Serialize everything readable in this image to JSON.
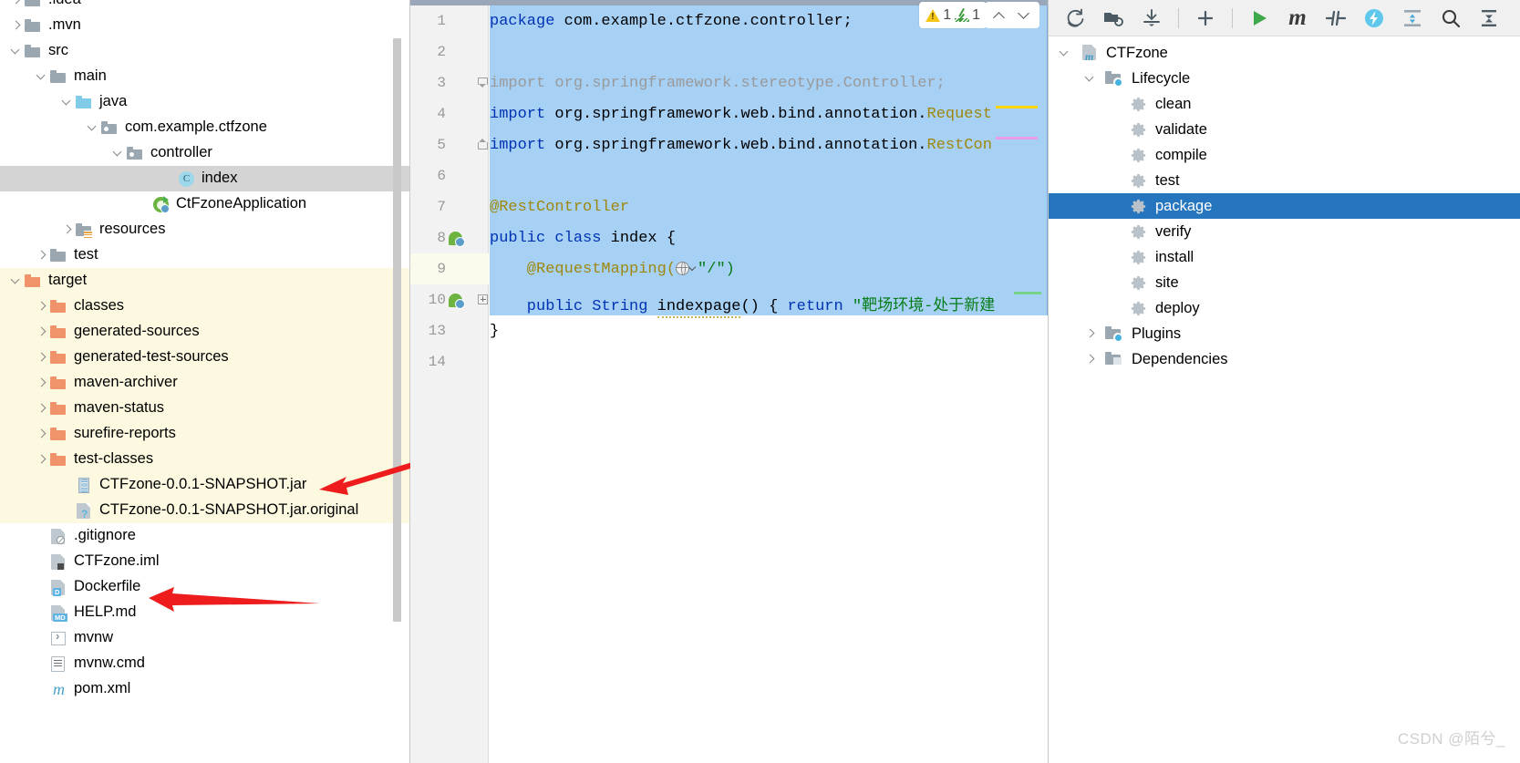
{
  "project_panel": {
    "items": [
      {
        "label": ".idea",
        "depth": 0,
        "arrow": "right",
        "icon": "folder-gray",
        "indent": 30,
        "clipped_top": true
      },
      {
        "label": ".mvn",
        "depth": 0,
        "arrow": "right",
        "icon": "folder-gray",
        "indent": 30
      },
      {
        "label": "src",
        "depth": 0,
        "arrow": "down",
        "icon": "folder-gray",
        "indent": 30
      },
      {
        "label": "main",
        "depth": 1,
        "arrow": "down",
        "icon": "folder-gray",
        "indent": 58
      },
      {
        "label": "java",
        "depth": 2,
        "arrow": "down",
        "icon": "folder-blue",
        "indent": 86
      },
      {
        "label": "com.example.ctfzone",
        "depth": 3,
        "arrow": "down",
        "icon": "folder-package",
        "indent": 114
      },
      {
        "label": "controller",
        "depth": 4,
        "arrow": "down",
        "icon": "folder-package",
        "indent": 142
      },
      {
        "label": "index",
        "depth": 5,
        "arrow": "none",
        "icon": "java-class",
        "indent": 198,
        "selected": true
      },
      {
        "label": "CtFzoneApplication",
        "depth": 5,
        "arrow": "none",
        "icon": "spring-boot",
        "indent": 170
      },
      {
        "label": "resources",
        "depth": 2,
        "arrow": "right",
        "icon": "folder-resources",
        "indent": 86
      },
      {
        "label": "test",
        "depth": 1,
        "arrow": "right",
        "icon": "folder-gray",
        "indent": 58
      },
      {
        "label": "target",
        "depth": 0,
        "arrow": "down",
        "icon": "folder-orange",
        "indent": 30,
        "in_target": true
      },
      {
        "label": "classes",
        "depth": 1,
        "arrow": "right",
        "icon": "folder-orange",
        "indent": 58,
        "in_target": true
      },
      {
        "label": "generated-sources",
        "depth": 1,
        "arrow": "right",
        "icon": "folder-orange",
        "indent": 58,
        "in_target": true
      },
      {
        "label": "generated-test-sources",
        "depth": 1,
        "arrow": "right",
        "icon": "folder-orange",
        "indent": 58,
        "in_target": true
      },
      {
        "label": "maven-archiver",
        "depth": 1,
        "arrow": "right",
        "icon": "folder-orange",
        "indent": 58,
        "in_target": true
      },
      {
        "label": "maven-status",
        "depth": 1,
        "arrow": "right",
        "icon": "folder-orange",
        "indent": 58,
        "in_target": true
      },
      {
        "label": "surefire-reports",
        "depth": 1,
        "arrow": "right",
        "icon": "folder-orange",
        "indent": 58,
        "in_target": true
      },
      {
        "label": "test-classes",
        "depth": 1,
        "arrow": "right",
        "icon": "folder-orange",
        "indent": 58,
        "in_target": true
      },
      {
        "label": "CTFzone-0.0.1-SNAPSHOT.jar",
        "depth": 1,
        "arrow": "none",
        "icon": "jar-archive",
        "indent": 86,
        "in_target": true
      },
      {
        "label": "CTFzone-0.0.1-SNAPSHOT.jar.original",
        "depth": 1,
        "arrow": "none",
        "icon": "file-original",
        "indent": 86,
        "in_target": true
      },
      {
        "label": ".gitignore",
        "depth": 0,
        "arrow": "none",
        "icon": "file-gitignore",
        "indent": 58
      },
      {
        "label": "CTFzone.iml",
        "depth": 0,
        "arrow": "none",
        "icon": "file-iml",
        "indent": 58
      },
      {
        "label": "Dockerfile",
        "depth": 0,
        "arrow": "none",
        "icon": "file-docker",
        "indent": 58,
        "badge": "D"
      },
      {
        "label": "HELP.md",
        "depth": 0,
        "arrow": "none",
        "icon": "file-markdown",
        "indent": 58,
        "badge": "MD"
      },
      {
        "label": "mvnw",
        "depth": 0,
        "arrow": "none",
        "icon": "file-script",
        "indent": 58
      },
      {
        "label": "mvnw.cmd",
        "depth": 0,
        "arrow": "none",
        "icon": "file-cmd",
        "indent": 58
      },
      {
        "label": "pom.xml",
        "depth": 0,
        "arrow": "none",
        "icon": "file-maven-pom",
        "indent": 58
      }
    ]
  },
  "editor": {
    "gutter_line_numbers": [
      "1",
      "2",
      "3",
      "4",
      "5",
      "6",
      "7",
      "8",
      "9",
      "10",
      "13",
      "14"
    ],
    "highlighted_line": "9",
    "code_lines": [
      {
        "n": "1",
        "segments": [
          {
            "t": "package ",
            "c": "kw"
          },
          {
            "t": "com.example.ctfzone.controller;",
            "c": ""
          }
        ]
      },
      {
        "n": "2",
        "segments": []
      },
      {
        "n": "3",
        "segments": [
          {
            "t": "import org.springframework.stereotype.Controller;",
            "c": "gray"
          }
        ]
      },
      {
        "n": "4",
        "segments": [
          {
            "t": "import ",
            "c": "kw"
          },
          {
            "t": "org.springframework.web.bind.annotation.",
            "c": ""
          },
          {
            "t": "Request",
            "c": "ann"
          }
        ]
      },
      {
        "n": "5",
        "segments": [
          {
            "t": "import ",
            "c": "kw"
          },
          {
            "t": "org.springframework.web.bind.annotation.",
            "c": ""
          },
          {
            "t": "RestCon",
            "c": "ann"
          }
        ]
      },
      {
        "n": "6",
        "segments": []
      },
      {
        "n": "7",
        "segments": [
          {
            "t": "@RestController",
            "c": "ann"
          }
        ]
      },
      {
        "n": "8",
        "segments": [
          {
            "t": "public class ",
            "c": "kw"
          },
          {
            "t": "index {",
            "c": ""
          }
        ]
      },
      {
        "n": "9",
        "segments": [
          {
            "t": "    @RequestMapping(",
            "c": "ann"
          },
          {
            "t": "GLOBE",
            "c": "icon"
          },
          {
            "t": "\"/\")",
            "c": "str"
          }
        ]
      },
      {
        "n": "10",
        "segments": [
          {
            "t": "    public String ",
            "c": "kw"
          },
          {
            "t": "indexpage",
            "c": "wave"
          },
          {
            "t": "() { ",
            "c": ""
          },
          {
            "t": "return ",
            "c": "kw"
          },
          {
            "t": "\"靶场环境-处于新建",
            "c": "str"
          }
        ]
      },
      {
        "n": "13",
        "segments": [
          {
            "t": "}",
            "c": ""
          }
        ]
      },
      {
        "n": "14",
        "segments": []
      }
    ],
    "inspection": {
      "warning_count": "1",
      "check_count": "1"
    },
    "nav": {
      "up_label": "previous-highlight",
      "down_label": "next-highlight"
    }
  },
  "maven_panel": {
    "toolbar": [
      {
        "name": "reload-all-maven-projects-icon",
        "glyph": "reload"
      },
      {
        "name": "generate-sources-icon",
        "glyph": "folder-refresh"
      },
      {
        "name": "download-sources-icon",
        "glyph": "download"
      },
      {
        "name": "add-maven-project-icon",
        "glyph": "plus"
      },
      {
        "name": "run-maven-build-icon",
        "glyph": "run"
      },
      {
        "name": "execute-maven-goal-icon",
        "glyph": "m"
      },
      {
        "name": "toggle-skip-tests-icon",
        "glyph": "skip-tests"
      },
      {
        "name": "toggle-offline-mode-icon",
        "glyph": "offline"
      },
      {
        "name": "expand-all-icon",
        "glyph": "expand"
      },
      {
        "name": "search-icon",
        "glyph": "search"
      },
      {
        "name": "collapse-all-icon",
        "glyph": "collapse"
      }
    ],
    "tree": [
      {
        "label": "CTFzone",
        "depth": 0,
        "arrow": "down",
        "icon": "maven-module",
        "indent": 10
      },
      {
        "label": "Lifecycle",
        "depth": 1,
        "arrow": "down",
        "icon": "folder-config",
        "indent": 38
      },
      {
        "label": "clean",
        "depth": 2,
        "arrow": "none",
        "icon": "goal-gear",
        "indent": 88
      },
      {
        "label": "validate",
        "depth": 2,
        "arrow": "none",
        "icon": "goal-gear",
        "indent": 88
      },
      {
        "label": "compile",
        "depth": 2,
        "arrow": "none",
        "icon": "goal-gear",
        "indent": 88
      },
      {
        "label": "test",
        "depth": 2,
        "arrow": "none",
        "icon": "goal-gear",
        "indent": 88
      },
      {
        "label": "package",
        "depth": 2,
        "arrow": "none",
        "icon": "goal-gear",
        "indent": 88,
        "selected": true
      },
      {
        "label": "verify",
        "depth": 2,
        "arrow": "none",
        "icon": "goal-gear",
        "indent": 88
      },
      {
        "label": "install",
        "depth": 2,
        "arrow": "none",
        "icon": "goal-gear",
        "indent": 88
      },
      {
        "label": "site",
        "depth": 2,
        "arrow": "none",
        "icon": "goal-gear",
        "indent": 88
      },
      {
        "label": "deploy",
        "depth": 2,
        "arrow": "none",
        "icon": "goal-gear",
        "indent": 88
      },
      {
        "label": "Plugins",
        "depth": 1,
        "arrow": "right",
        "icon": "folder-config",
        "indent": 38
      },
      {
        "label": "Dependencies",
        "depth": 1,
        "arrow": "right",
        "icon": "folder-deps",
        "indent": 38
      }
    ]
  },
  "annotations": {
    "arrow_to_jar": "red-arrow-pointing-at-snapshot-jar",
    "arrow_to_dockerfile": "red-arrow-pointing-at-dockerfile"
  },
  "watermark": {
    "text": "CSDN @陌兮_"
  }
}
